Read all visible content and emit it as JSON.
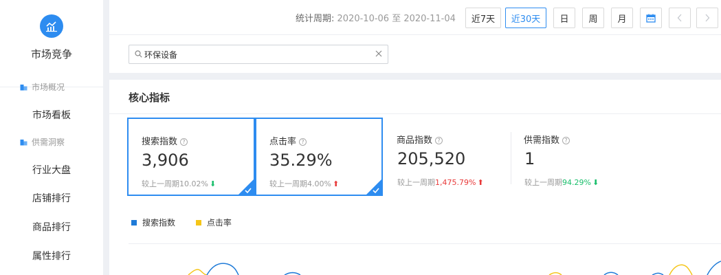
{
  "sidebar": {
    "brand_title": "市场竞争",
    "groups": [
      {
        "label": "市场概况",
        "items": [
          "市场看板"
        ]
      },
      {
        "label": "供需洞察",
        "items": [
          "行业大盘",
          "店铺排行",
          "商品排行",
          "属性排行"
        ]
      }
    ]
  },
  "topbar": {
    "period_label": "统计周期:",
    "period_dates": "2020-10-06 至 2020-11-04",
    "buttons": {
      "last7": "近7天",
      "last30": "近30天",
      "day": "日",
      "week": "周",
      "month": "月"
    },
    "active_button": "近30天",
    "icons": [
      "calendar-icon",
      "chevron-left-icon",
      "chevron-right-icon"
    ]
  },
  "search": {
    "value": "环保设备",
    "placeholder": ""
  },
  "panel": {
    "title": "核心指标",
    "compare_label": "较上一周期",
    "cards": [
      {
        "name": "搜索指数",
        "value": "3,906",
        "change": "10.02%",
        "direction": "down",
        "selected": true
      },
      {
        "name": "点击率",
        "value": "35.29%",
        "change": "4.00%",
        "direction": "up",
        "selected": true
      },
      {
        "name": "商品指数",
        "value": "205,520",
        "change": "1,475.79%",
        "direction": "up",
        "selected": false
      },
      {
        "name": "供需指数",
        "value": "1",
        "change": "94.29%",
        "direction": "down",
        "selected": false
      }
    ],
    "legend": [
      {
        "label": "搜索指数",
        "color": "#1f7bd8"
      },
      {
        "label": "点击率",
        "color": "#f5c518"
      }
    ]
  },
  "colors": {
    "accent": "#2d8cf0",
    "up": "#e83a3a",
    "down": "#19be6b"
  }
}
